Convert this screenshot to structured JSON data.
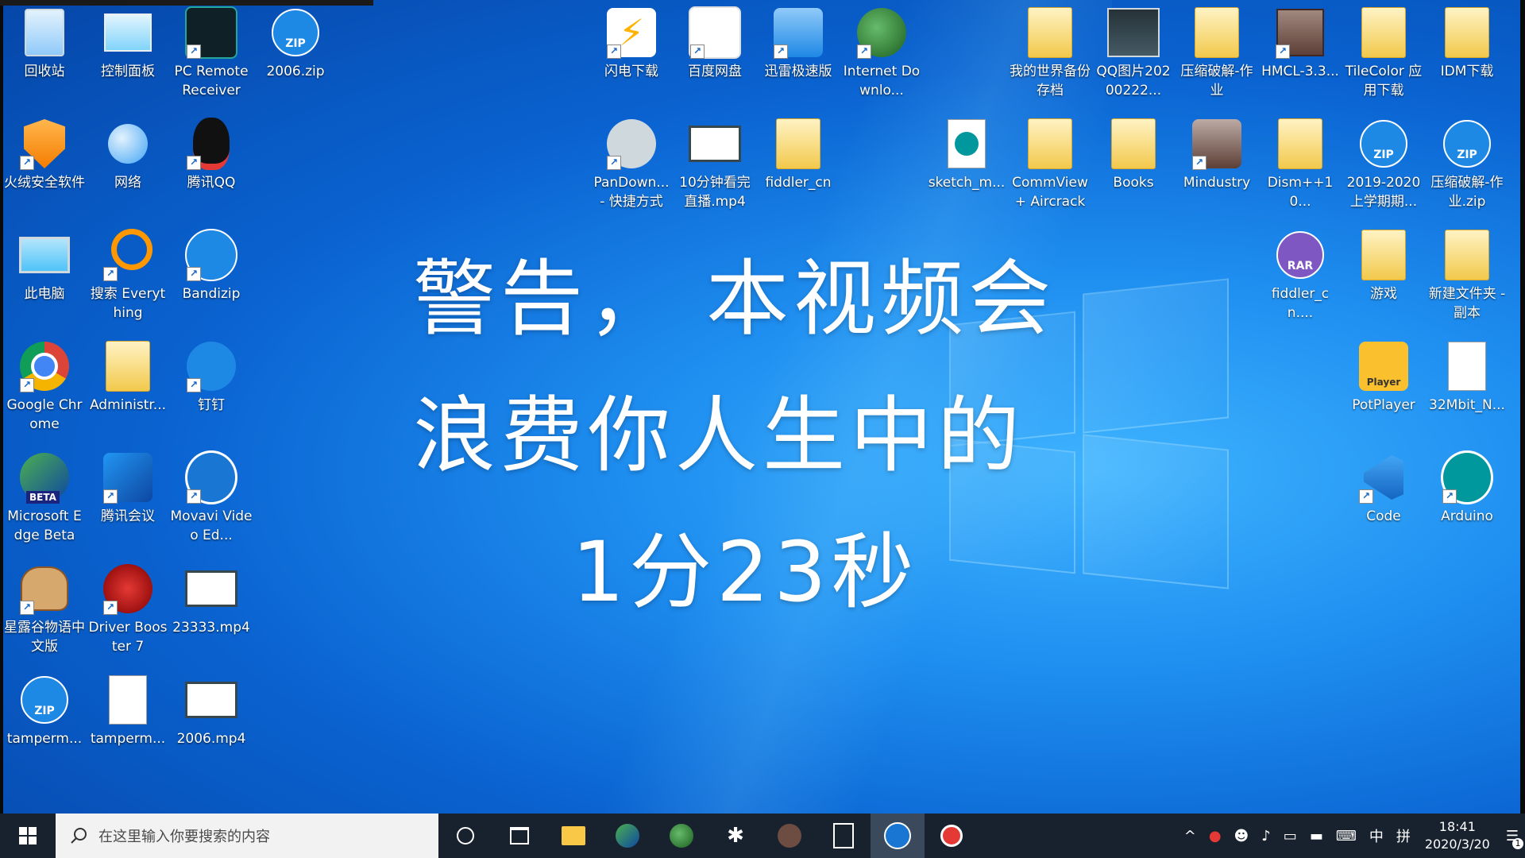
{
  "desktop": {
    "icons_col1": [
      {
        "label": "回收站"
      },
      {
        "label": "火绒安全软件"
      },
      {
        "label": "此电脑"
      },
      {
        "label": "Google Chrome"
      },
      {
        "label": "Microsoft Edge Beta"
      },
      {
        "label": "星露谷物语中文版"
      },
      {
        "label": "tamperm..."
      }
    ],
    "icons_col2": [
      {
        "label": "控制面板"
      },
      {
        "label": "网络"
      },
      {
        "label": "搜索 Everything"
      },
      {
        "label": "Administr..."
      },
      {
        "label": "腾讯会议"
      },
      {
        "label": "Driver Booster 7"
      },
      {
        "label": "tamperm..."
      }
    ],
    "icons_col3": [
      {
        "label": "PC Remote Receiver"
      },
      {
        "label": "腾讯QQ"
      },
      {
        "label": "Bandizip"
      },
      {
        "label": "钉钉"
      },
      {
        "label": "Movavi Video Ed..."
      },
      {
        "label": "23333.mp4"
      },
      {
        "label": "2006.mp4"
      }
    ],
    "icon_2006zip": {
      "label": "2006.zip",
      "badge": "ZIP"
    },
    "top_middle": [
      {
        "label": "闪电下载"
      },
      {
        "label": "百度网盘"
      },
      {
        "label": "迅雷极速版"
      },
      {
        "label": "Internet Downlo..."
      }
    ],
    "second_middle": [
      {
        "label": "PanDown... - 快捷方式"
      },
      {
        "label": "10分钟看完直播.mp4"
      },
      {
        "label": "fiddler_cn"
      }
    ],
    "top_right": [
      {
        "label": "我的世界备份存档"
      },
      {
        "label": "QQ图片20200222..."
      },
      {
        "label": "压缩破解-作业"
      },
      {
        "label": "HMCL-3.3..."
      },
      {
        "label": "TileColor 应用下载"
      },
      {
        "label": "IDM下载"
      }
    ],
    "second_right": [
      {
        "label": "sketch_m..."
      },
      {
        "label": "CommView + Aircrack"
      },
      {
        "label": "Books"
      },
      {
        "label": "Mindustry"
      },
      {
        "label": "Dism++10..."
      },
      {
        "label": "2019-2020上学期期...",
        "badge": "ZIP"
      },
      {
        "label": "压缩破解-作业.zip",
        "badge": "ZIP"
      }
    ],
    "third_right": [
      {
        "label": "fiddler_cn....",
        "badge": "RAR"
      },
      {
        "label": "游戏"
      },
      {
        "label": "新建文件夹 - 副本"
      }
    ],
    "fourth_right": [
      {
        "label": "PotPlayer",
        "badge": "Player"
      },
      {
        "label": "32Mbit_N..."
      }
    ],
    "fifth_right": [
      {
        "label": "Code"
      },
      {
        "label": "Arduino"
      }
    ],
    "beta_badge": "BETA"
  },
  "overlay": {
    "line1": "警告， 本视频会",
    "line2": "浪费你人生中的",
    "line3": "1分23秒"
  },
  "taskbar": {
    "search_placeholder": "在这里输入你要搜索的内容",
    "ime_lang": "中",
    "ime_mode": "拼",
    "time": "18:41",
    "date": "2020/3/20",
    "notification_count": "1"
  },
  "colors": {
    "taskbar_bg": "#18222e",
    "desktop_accent": "#1e8ef0"
  }
}
